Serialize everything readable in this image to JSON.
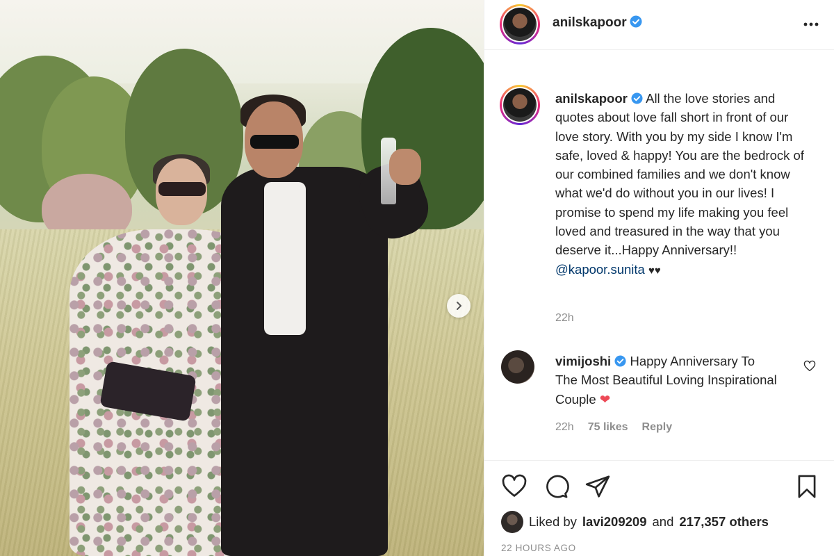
{
  "post": {
    "username": "anilskapoor",
    "caption_text": "All the love stories and quotes about love fall short in front of our love story. With you by my side I know I'm safe, loved & happy! You are the bedrock of our combined families and we don't know what we'd do without you in our lives! I promise to spend my life making you feel loved and treasured in the way that you deserve it...Happy Anniversary!!",
    "mention": "@kapoor.sunita",
    "caption_hearts": "♥♥",
    "caption_time": "22h",
    "posted_ago": "22 HOURS AGO"
  },
  "comment": {
    "username": "vimijoshi",
    "text": "Happy Anniversary To The Most Beautiful Loving Inspirational Couple",
    "heart": "❤",
    "time": "22h",
    "likes": "75 likes",
    "reply_label": "Reply"
  },
  "likes": {
    "prefix": "Liked by",
    "user": "lavi209209",
    "and_text": "and",
    "others": "217,357 others"
  },
  "icons": {
    "more": "more-options-icon",
    "verified": "verified-badge-icon",
    "next": "carousel-next-icon",
    "like": "heart-icon",
    "comment": "comment-icon",
    "share": "share-icon",
    "save": "bookmark-icon"
  },
  "colors": {
    "text": "#262626",
    "secondary": "#8e8e8e",
    "verified": "#3897f0",
    "link": "#00376b",
    "heart_red": "#ed4956"
  }
}
